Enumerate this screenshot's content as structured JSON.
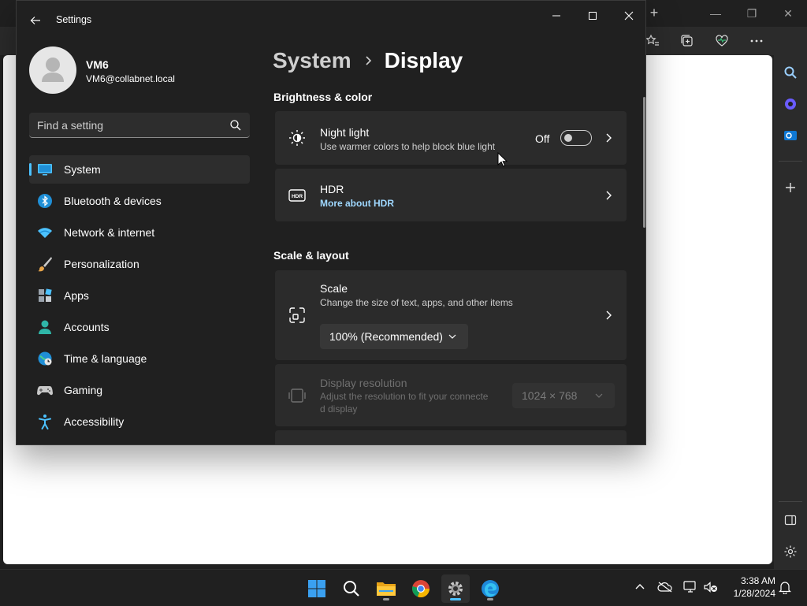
{
  "settings_window": {
    "title": "Settings",
    "user": {
      "name": "VM6",
      "email": "VM6@collabnet.local"
    },
    "search": {
      "placeholder": "Find a setting",
      "value": ""
    },
    "nav": [
      {
        "label": "System",
        "icon": "system-icon",
        "selected": true
      },
      {
        "label": "Bluetooth & devices",
        "icon": "bluetooth-icon"
      },
      {
        "label": "Network & internet",
        "icon": "wifi-icon"
      },
      {
        "label": "Personalization",
        "icon": "brush-icon"
      },
      {
        "label": "Apps",
        "icon": "apps-icon"
      },
      {
        "label": "Accounts",
        "icon": "account-icon"
      },
      {
        "label": "Time & language",
        "icon": "globe-clock-icon"
      },
      {
        "label": "Gaming",
        "icon": "gamepad-icon"
      },
      {
        "label": "Accessibility",
        "icon": "accessibility-icon"
      }
    ],
    "breadcrumb": {
      "parent": "System",
      "current": "Display"
    },
    "sections": {
      "brightness": {
        "heading": "Brightness & color",
        "night_light": {
          "title": "Night light",
          "subtitle": "Use warmer colors to help block blue light",
          "state": "Off",
          "on": false
        },
        "hdr": {
          "title": "HDR",
          "link": "More about HDR"
        }
      },
      "scale_layout": {
        "heading": "Scale & layout",
        "scale": {
          "title": "Scale",
          "subtitle": "Change the size of text, apps, and other items",
          "value": "100% (Recommended)"
        },
        "resolution": {
          "title": "Display resolution",
          "subtitle_line1": "Adjust the resolution to fit your connecte",
          "subtitle_line2": "d display",
          "value": "1024 × 768"
        }
      }
    }
  },
  "taskbar": {
    "apps": [
      "start-icon",
      "search-icon",
      "file-explorer-icon",
      "chrome-icon",
      "settings-icon",
      "edge-icon"
    ],
    "time": "3:38 AM",
    "date": "1/28/2024"
  },
  "colors": {
    "accent": "#4cc2ff",
    "window_bg": "#202020",
    "card_bg": "#2b2b2b",
    "link": "#9fd8ff"
  }
}
